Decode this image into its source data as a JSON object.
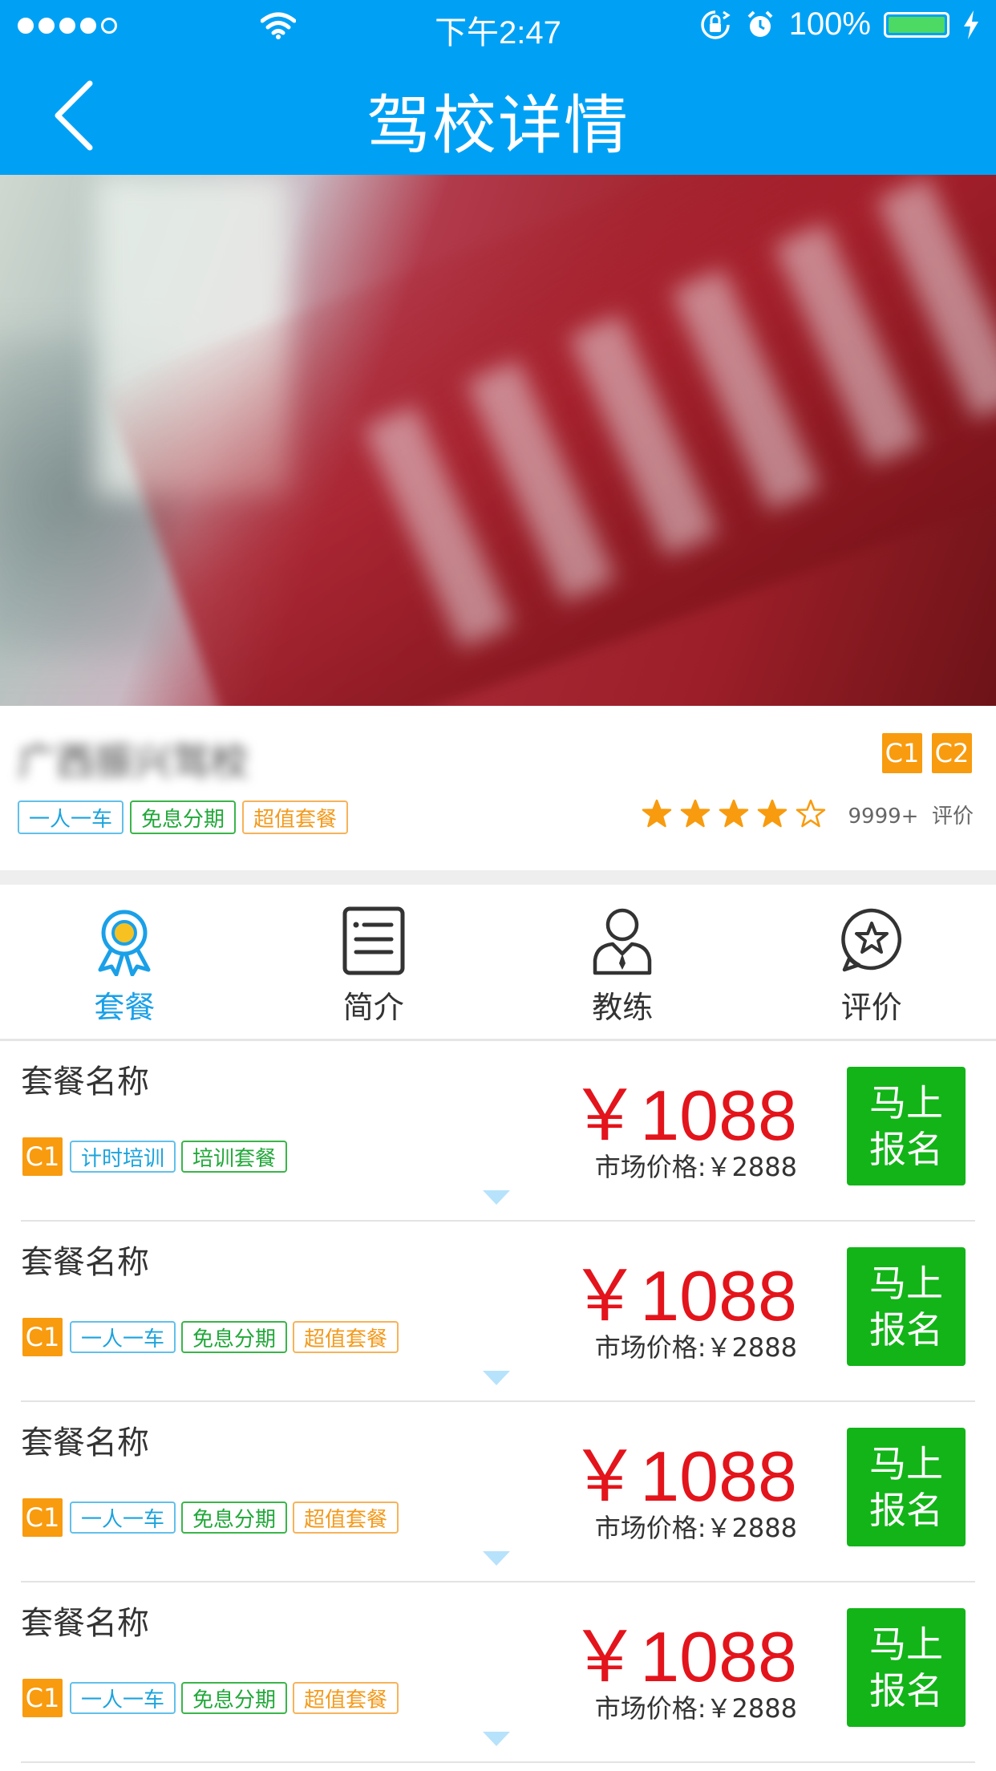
{
  "status_bar": {
    "time": "下午2:47",
    "battery": "100%"
  },
  "nav": {
    "title": "驾校详情"
  },
  "school": {
    "name": "广西振兴驾校",
    "licenses": [
      "C1",
      "C2"
    ],
    "tags": [
      "一人一车",
      "免息分期",
      "超值套餐"
    ],
    "rating": 4,
    "rating_max": 5,
    "review_count": "9999+",
    "review_label": "评价"
  },
  "tabs": [
    {
      "label": "套餐",
      "icon": "medal-icon",
      "active": true
    },
    {
      "label": "简介",
      "icon": "document-icon",
      "active": false
    },
    {
      "label": "教练",
      "icon": "coach-icon",
      "active": false
    },
    {
      "label": "评价",
      "icon": "star-bubble-icon",
      "active": false
    }
  ],
  "packages": [
    {
      "name": "套餐名称",
      "license": "C1",
      "tags": [
        {
          "text": "计时培训",
          "color": "blue"
        },
        {
          "text": "培训套餐",
          "color": "green"
        }
      ],
      "price": "￥1088",
      "market_label": "市场价格:",
      "market_price": "￥2888",
      "button": "马上报名"
    },
    {
      "name": "套餐名称",
      "license": "C1",
      "tags": [
        {
          "text": "一人一车",
          "color": "blue"
        },
        {
          "text": "免息分期",
          "color": "green"
        },
        {
          "text": "超值套餐",
          "color": "orange"
        }
      ],
      "price": "￥1088",
      "market_label": "市场价格:",
      "market_price": "￥2888",
      "button": "马上报名"
    },
    {
      "name": "套餐名称",
      "license": "C1",
      "tags": [
        {
          "text": "一人一车",
          "color": "blue"
        },
        {
          "text": "免息分期",
          "color": "green"
        },
        {
          "text": "超值套餐",
          "color": "orange"
        }
      ],
      "price": "￥1088",
      "market_label": "市场价格:",
      "market_price": "￥2888",
      "button": "马上报名"
    },
    {
      "name": "套餐名称",
      "license": "C1",
      "tags": [
        {
          "text": "一人一车",
          "color": "blue"
        },
        {
          "text": "免息分期",
          "color": "green"
        },
        {
          "text": "超值套餐",
          "color": "orange"
        }
      ],
      "price": "￥1088",
      "market_label": "市场价格:",
      "market_price": "￥2888",
      "button": "马上报名"
    }
  ],
  "colors": {
    "primary": "#00a1f5",
    "price": "#e3141b",
    "signup": "#12b418",
    "license": "#f89b0e",
    "star": "#f89b0e"
  }
}
